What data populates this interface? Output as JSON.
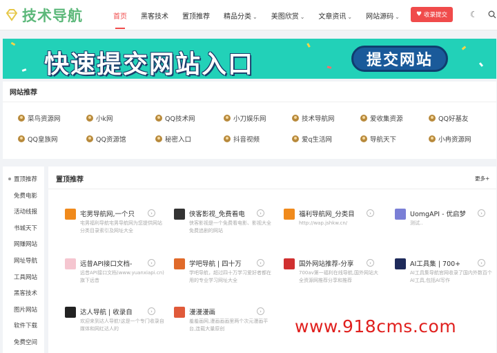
{
  "brand": {
    "name": "技术导航"
  },
  "nav": [
    {
      "label": "首页",
      "caret": false,
      "active": true
    },
    {
      "label": "黑客技术",
      "caret": false
    },
    {
      "label": "置顶推荐",
      "caret": false
    },
    {
      "label": "精品分类",
      "caret": true
    },
    {
      "label": "美图欣赏",
      "caret": true
    },
    {
      "label": "文章资讯",
      "caret": true
    },
    {
      "label": "网站源码",
      "caret": true
    }
  ],
  "submit_button": "收录提交",
  "banner": {
    "headline": "快速提交网站入口",
    "button": "提交网站"
  },
  "recommend": {
    "title": "网站推荐",
    "items": [
      "菜鸟资源网",
      "小k网",
      "QQ技术网",
      "小刀娱乐网",
      "技术导航网",
      "爱收集资源",
      "QQ好基友",
      "QQ皇族网",
      "QQ资源馆",
      "秘密入口",
      "抖音视频",
      "爱q生活网",
      "导航天下",
      "小冉资源网"
    ]
  },
  "sidebar": [
    "置顶推荐",
    "免费电影",
    "活动线报",
    "书城天下",
    "网赚网站",
    "网址导航",
    "工具网站",
    "黑客技术",
    "图片网站",
    "软件下载",
    "免费空间"
  ],
  "main": {
    "title": "置顶推荐",
    "more": "更多+",
    "cards": [
      {
        "name": "宅男导航网,一个只",
        "desc": "宅男福利导航宅男导航网为您提供网站分类目录索引及网址大全",
        "icon_color": "#f08a1c"
      },
      {
        "name": "侠客影视_免费看电",
        "desc": "侠客影视是一个免费看电影、影视大全免费追剧的网站",
        "icon_color": "#333333"
      },
      {
        "name": "福利导航网_分类目",
        "desc": "http://wap.jshkw.cn/",
        "icon_color": "#f08a1c"
      },
      {
        "name": "UomgAPI - 优启梦",
        "desc": "测试..",
        "icon_color": "#7a7fd6"
      },
      {
        "name": "远昔API接口文档-",
        "desc": "远昔API接口文档(www.yuanxiapi.cn)旗下远昔",
        "icon_color": "#f5c6d0"
      },
      {
        "name": "学吧导航 | 四十万",
        "desc": "学吧导航，超过四十万学习爱好者都在用的专业学习网址大全",
        "icon_color": "#e06a2a"
      },
      {
        "name": "国外网站推荐-分享",
        "desc": "700av第一福利在线导航,国外网站大全资源网推荐分享和推荐",
        "icon_color": "#d03030"
      },
      {
        "name": "AI工具集 | 700+",
        "desc": "AI工具集导航官网收录了国内外数百个AI工具,包括AI写作",
        "icon_color": "#1e2a5a"
      },
      {
        "name": "达人导航 | 收录自",
        "desc": "欢迎来到达人导航!这是一个专门收录自媒体和网红达人的",
        "icon_color": "#222222"
      },
      {
        "name": "漫漫漫画",
        "desc": "羞羞画网,漫画画画里两个次元漫画平台,连载大量原创",
        "icon_color": "#e05a3a"
      }
    ]
  },
  "watermark": "www.918cms.com"
}
